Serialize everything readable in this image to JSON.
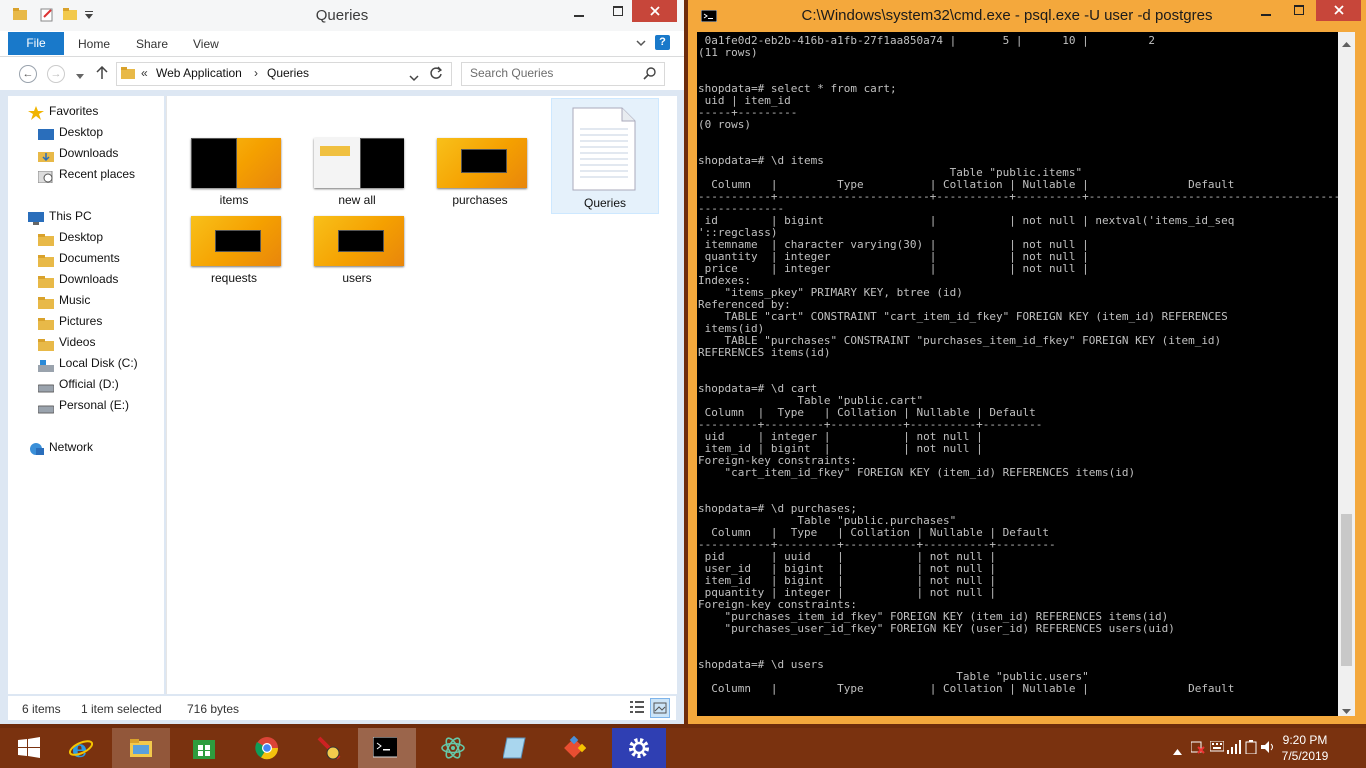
{
  "explorer": {
    "title": "Queries",
    "ribbon_tabs": {
      "file": "File",
      "home": "Home",
      "share": "Share",
      "view": "View"
    },
    "address": {
      "overflow": "«",
      "crumbs": [
        "Web Application",
        "Queries"
      ]
    },
    "search_placeholder": "Search Queries",
    "nav": {
      "favorites": "Favorites",
      "fav_items": [
        "Desktop",
        "Downloads",
        "Recent places"
      ],
      "this_pc": "This PC",
      "pc_items": [
        "Desktop",
        "Documents",
        "Downloads",
        "Music",
        "Pictures",
        "Videos",
        "Local Disk (C:)",
        "Official (D:)",
        "Personal (E:)"
      ],
      "network": "Network"
    },
    "files": [
      "items",
      "new all",
      "purchases",
      "Queries",
      "requests",
      "users"
    ],
    "status": {
      "count": "6 items",
      "selection": "1 item selected",
      "size": "716 bytes"
    }
  },
  "cmd": {
    "title": "C:\\Windows\\system32\\cmd.exe - psql.exe  -U user -d postgres",
    "console_lines": [
      " 0a1fe0d2-eb2b-416b-a1fb-27f1aa850a74 |       5 |      10 |         2",
      "(11 rows)",
      "",
      "",
      "shopdata=# select * from cart;",
      " uid | item_id",
      "-----+---------",
      "(0 rows)",
      "",
      "",
      "shopdata=# \\d items",
      "                                      Table \"public.items\"",
      "  Column   |         Type          | Collation | Nullable |               Default",
      "-----------+-----------------------+-----------+----------+------------------------------------------",
      "-------------",
      " id        | bigint                |           | not null | nextval('items_id_seq",
      "'::regclass)",
      " itemname  | character varying(30) |           | not null |",
      " quantity  | integer               |           | not null |",
      " price     | integer               |           | not null |",
      "Indexes:",
      "    \"items_pkey\" PRIMARY KEY, btree (id)",
      "Referenced by:",
      "    TABLE \"cart\" CONSTRAINT \"cart_item_id_fkey\" FOREIGN KEY (item_id) REFERENCES",
      " items(id)",
      "    TABLE \"purchases\" CONSTRAINT \"purchases_item_id_fkey\" FOREIGN KEY (item_id)",
      "REFERENCES items(id)",
      "",
      "",
      "shopdata=# \\d cart",
      "               Table \"public.cart\"",
      " Column  |  Type   | Collation | Nullable | Default",
      "---------+---------+-----------+----------+---------",
      " uid     | integer |           | not null |",
      " item_id | bigint  |           | not null |",
      "Foreign-key constraints:",
      "    \"cart_item_id_fkey\" FOREIGN KEY (item_id) REFERENCES items(id)",
      "",
      "",
      "shopdata=# \\d purchases;",
      "               Table \"public.purchases\"",
      "  Column   |  Type   | Collation | Nullable | Default",
      "-----------+---------+-----------+----------+---------",
      " pid       | uuid    |           | not null |",
      " user_id   | bigint  |           | not null |",
      " item_id   | bigint  |           | not null |",
      " pquantity | integer |           | not null |",
      "Foreign-key constraints:",
      "    \"purchases_item_id_fkey\" FOREIGN KEY (item_id) REFERENCES items(id)",
      "    \"purchases_user_id_fkey\" FOREIGN KEY (user_id) REFERENCES users(uid)",
      "",
      "",
      "shopdata=# \\d users",
      "                                       Table \"public.users\"",
      "  Column   |         Type          | Collation | Nullable |               Default"
    ]
  },
  "taskbar": {
    "apps": [
      "start",
      "internet-explorer",
      "file-explorer",
      "store",
      "chrome",
      "filezilla",
      "command-prompt",
      "atom",
      "notepad",
      "git",
      "settings"
    ],
    "time": "9:20 PM",
    "date": "7/5/2019"
  }
}
